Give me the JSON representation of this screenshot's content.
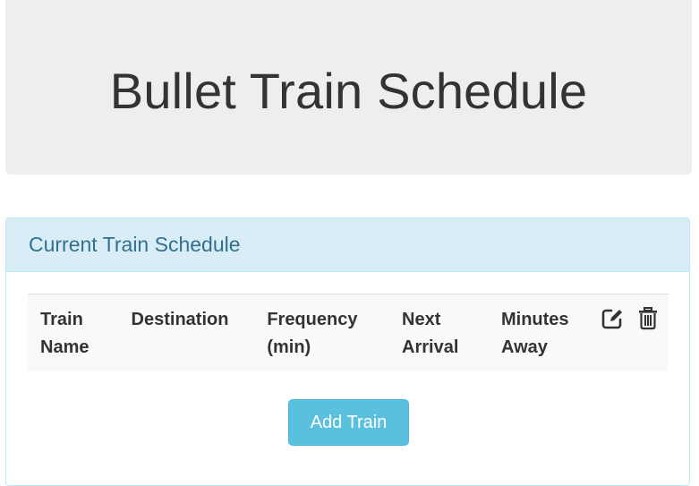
{
  "header": {
    "title": "Bullet Train Schedule"
  },
  "panel": {
    "title": "Current Train Schedule",
    "columns": [
      {
        "line1": "Train",
        "line2": "Name"
      },
      {
        "line1": "Destination",
        "line2": ""
      },
      {
        "line1": "Frequency",
        "line2": "(min)"
      },
      {
        "line1": "Next",
        "line2": "Arrival"
      },
      {
        "line1": "Minutes",
        "line2": "Away"
      }
    ],
    "icons": [
      "edit-icon",
      "trash-icon"
    ],
    "add_button_label": "Add Train"
  },
  "colors": {
    "panel_heading_bg": "#d9edf7",
    "panel_heading_text": "#31708f",
    "button_bg": "#5bc0de",
    "jumbotron_bg": "#eeeeee"
  }
}
